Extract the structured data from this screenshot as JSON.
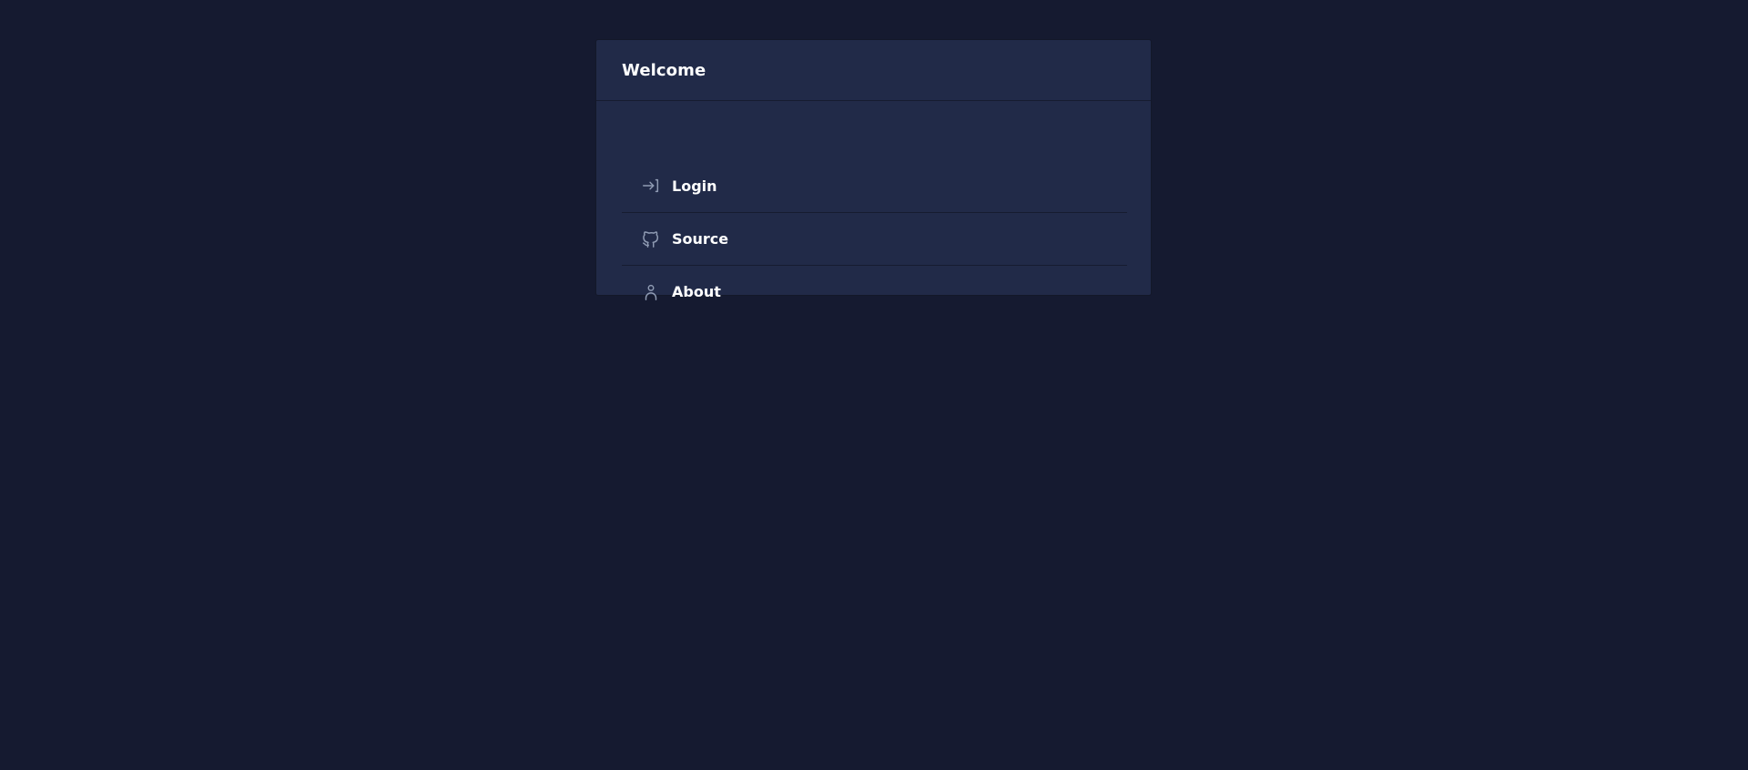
{
  "card": {
    "title": "Welcome"
  },
  "menu": {
    "items": [
      {
        "label": "Login",
        "icon": "log-in-icon"
      },
      {
        "label": "Source",
        "icon": "github-icon"
      },
      {
        "label": "About",
        "icon": "person-icon"
      }
    ]
  },
  "colors": {
    "background": "#151a30",
    "card": "#212a48",
    "divider": "#161c30",
    "text": "#ffffff",
    "icon": "#8f9bb3"
  }
}
